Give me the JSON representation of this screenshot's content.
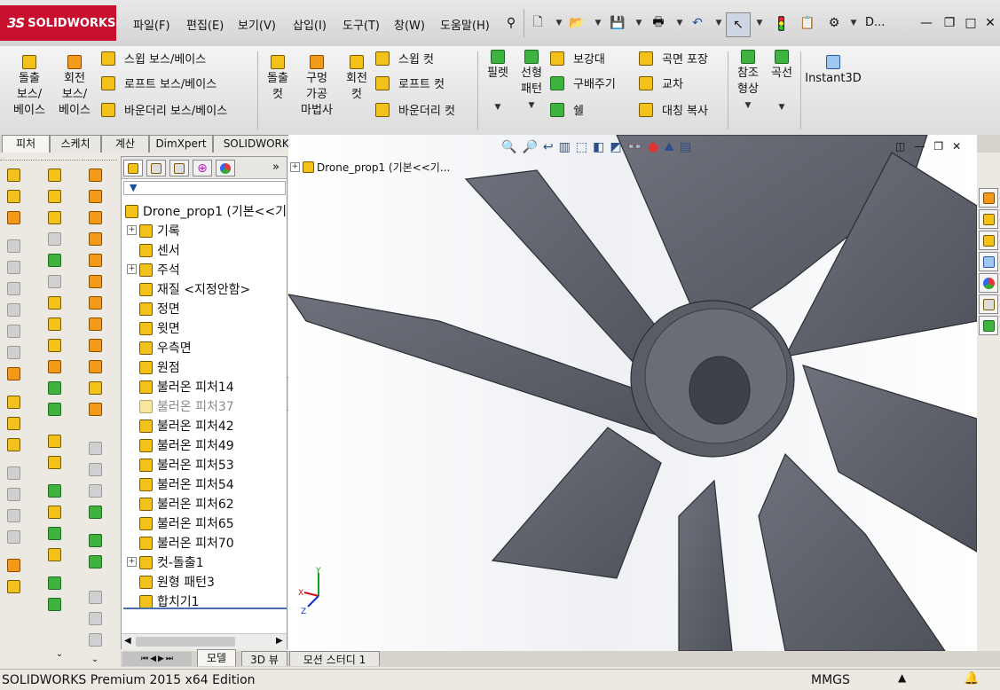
{
  "app": {
    "logo_text": "SOLIDWORKS",
    "logo_mark": "3S",
    "brand_color": "#c8102e"
  },
  "menu": {
    "items": [
      "파일(F)",
      "편집(E)",
      "보기(V)",
      "삽입(I)",
      "도구(T)",
      "창(W)",
      "도움말(H)"
    ]
  },
  "titlebar": {
    "title_abbrev": "D..."
  },
  "command_manager": {
    "big_buttons": [
      {
        "label": "돌출\n보스/\n베이스",
        "icon": "extrude-boss-icon"
      },
      {
        "label": "회전\n보스/\n베이스",
        "icon": "revolve-boss-icon"
      },
      {
        "label": "돌출\n컷",
        "icon": "extrude-cut-icon"
      },
      {
        "label": "구멍\n가공\n마법사",
        "icon": "hole-wizard-icon"
      },
      {
        "label": "회전\n컷",
        "icon": "revolve-cut-icon"
      },
      {
        "label": "필렛",
        "icon": "fillet-icon"
      },
      {
        "label": "선형\n패턴",
        "icon": "linear-pattern-icon"
      },
      {
        "label": "참조\n형상",
        "icon": "reference-geometry-icon"
      },
      {
        "label": "곡선",
        "icon": "curves-icon"
      },
      {
        "label": "Instant3D",
        "icon": "instant3d-icon"
      }
    ],
    "boss_group": [
      "스윕 보스/베이스",
      "로프트 보스/베이스",
      "바운더리 보스/베이스"
    ],
    "cut_group": [
      "스윕 컷",
      "로프트 컷",
      "바운더리 컷"
    ],
    "feature_group_a": [
      "보강대",
      "구배주기",
      "쉘"
    ],
    "feature_group_b": [
      "곡면 포장",
      "교차",
      "대칭 복사"
    ]
  },
  "tabs": [
    "피처",
    "스케치",
    "계산",
    "DimXpert",
    "SOLIDWORKS 애드인"
  ],
  "feature_tree": {
    "header_more": "»",
    "root": "Drone_prop1  (기본<<기",
    "items": [
      {
        "label": "기록",
        "expandable": true,
        "dim": false
      },
      {
        "label": "센서",
        "expandable": false,
        "dim": false
      },
      {
        "label": "주석",
        "expandable": true,
        "dim": false
      },
      {
        "label": "재질 <지정안함>",
        "expandable": false,
        "dim": false
      },
      {
        "label": "정면",
        "expandable": false,
        "dim": false
      },
      {
        "label": "윗면",
        "expandable": false,
        "dim": false
      },
      {
        "label": "우측면",
        "expandable": false,
        "dim": false
      },
      {
        "label": "원점",
        "expandable": false,
        "dim": false
      },
      {
        "label": "불러온 피처14",
        "expandable": false,
        "dim": false
      },
      {
        "label": "불러온 피처37",
        "expandable": false,
        "dim": true
      },
      {
        "label": "불러온 피처42",
        "expandable": false,
        "dim": false
      },
      {
        "label": "불러온 피처49",
        "expandable": false,
        "dim": false
      },
      {
        "label": "불러온 피처53",
        "expandable": false,
        "dim": false
      },
      {
        "label": "불러온 피처54",
        "expandable": false,
        "dim": false
      },
      {
        "label": "불러온 피처62",
        "expandable": false,
        "dim": false
      },
      {
        "label": "불러온 피처65",
        "expandable": false,
        "dim": false
      },
      {
        "label": "불러온 피처70",
        "expandable": false,
        "dim": false
      },
      {
        "label": "컷-돌출1",
        "expandable": true,
        "dim": false
      },
      {
        "label": "원형 패턴3",
        "expandable": false,
        "dim": false
      },
      {
        "label": "합치기1",
        "expandable": false,
        "dim": false
      }
    ]
  },
  "viewport": {
    "flyout_tree": "Drone_prop1  (기본<<기...",
    "axis": {
      "x": "X",
      "y": "Y",
      "z": "Z"
    },
    "model_color": "#5c5f68"
  },
  "bottom_tabs": [
    "모델",
    "3D 뷰",
    "모션 스터디 1"
  ],
  "status": {
    "left": "SOLIDWORKS Premium 2015 x64 Edition",
    "units": "MMGS"
  }
}
